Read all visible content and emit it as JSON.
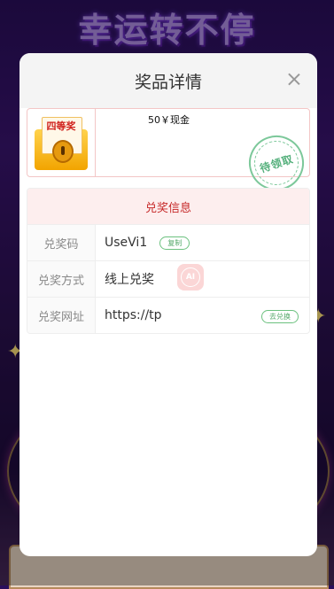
{
  "background": {
    "title": "幸运转不停"
  },
  "modal": {
    "title": "奖品详情",
    "prize": {
      "badge": "四等奖",
      "name": "50￥现金",
      "stamp": "待领取"
    },
    "info": {
      "header": "兑奖信息",
      "rows": [
        {
          "label": "兑奖码",
          "value": "UseVi1",
          "action": "复制"
        },
        {
          "label": "兑奖方式",
          "value": "线上兑奖"
        },
        {
          "label": "兑奖网址",
          "value": "https://tp",
          "action": "去兑换"
        }
      ]
    },
    "ai_badge": "AI"
  }
}
